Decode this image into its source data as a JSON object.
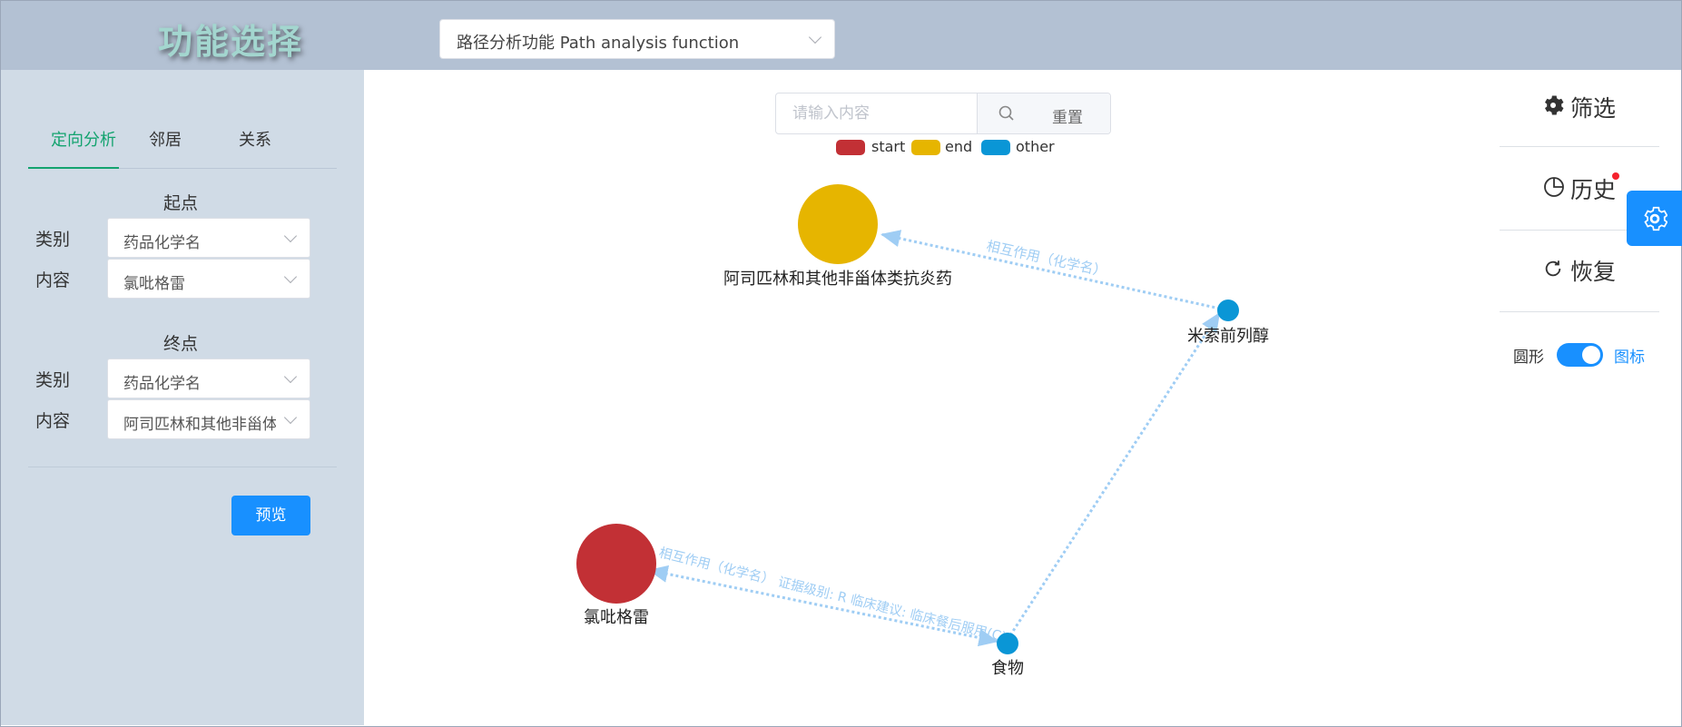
{
  "header": {
    "app_title": "功能选择",
    "function_select": "路径分析功能 Path analysis function"
  },
  "sidebar": {
    "tabs": [
      {
        "label": "定向分析",
        "active": true
      },
      {
        "label": "邻居",
        "active": false
      },
      {
        "label": "关系",
        "active": false
      }
    ],
    "start": {
      "title": "起点",
      "category_label": "类别",
      "category_value": "药品化学名",
      "content_label": "内容",
      "content_value": "氯吡格雷"
    },
    "end": {
      "title": "终点",
      "category_label": "类别",
      "category_value": "药品化学名",
      "content_label": "内容",
      "content_value": "阿司匹林和其他非甾体类抗炎药"
    },
    "preview_label": "预览"
  },
  "search": {
    "placeholder": "请输入内容",
    "value": "",
    "reset_label": "重置"
  },
  "legend": [
    {
      "label": "start",
      "color": "#c23035"
    },
    {
      "label": "end",
      "color": "#e6b500"
    },
    {
      "label": "other",
      "color": "#0a96d6"
    }
  ],
  "graph": {
    "nodes": [
      {
        "id": "aspirin",
        "label": "阿司匹林和其他非甾体类抗炎药",
        "role": "end"
      },
      {
        "id": "misoprostol",
        "label": "米索前列醇",
        "role": "other"
      },
      {
        "id": "clopidogrel",
        "label": "氯吡格雷",
        "role": "start"
      },
      {
        "id": "food",
        "label": "食物",
        "role": "other"
      }
    ],
    "edges": [
      {
        "from": "misoprostol",
        "to": "aspirin",
        "label": "相互作用（化学名）"
      },
      {
        "from": "food",
        "to": "misoprostol",
        "label": ""
      },
      {
        "from": "food",
        "to": "clopidogrel",
        "label": "相互作用（化学名） 证据级别: R 临床建议: 临床餐后服用(C)"
      }
    ],
    "edge_color": "#9fcdf4"
  },
  "right_panel": {
    "filter_label": "筛选",
    "history_label": "历史",
    "restore_label": "恢复",
    "toggle": {
      "left_label": "圆形",
      "right_label": "图标",
      "on": true
    }
  },
  "colors": {
    "accent": "#1890ff",
    "active_tab": "#13a36f",
    "sidebar_bg": "#d0dbe6",
    "header_bg": "#b3c1d3"
  }
}
